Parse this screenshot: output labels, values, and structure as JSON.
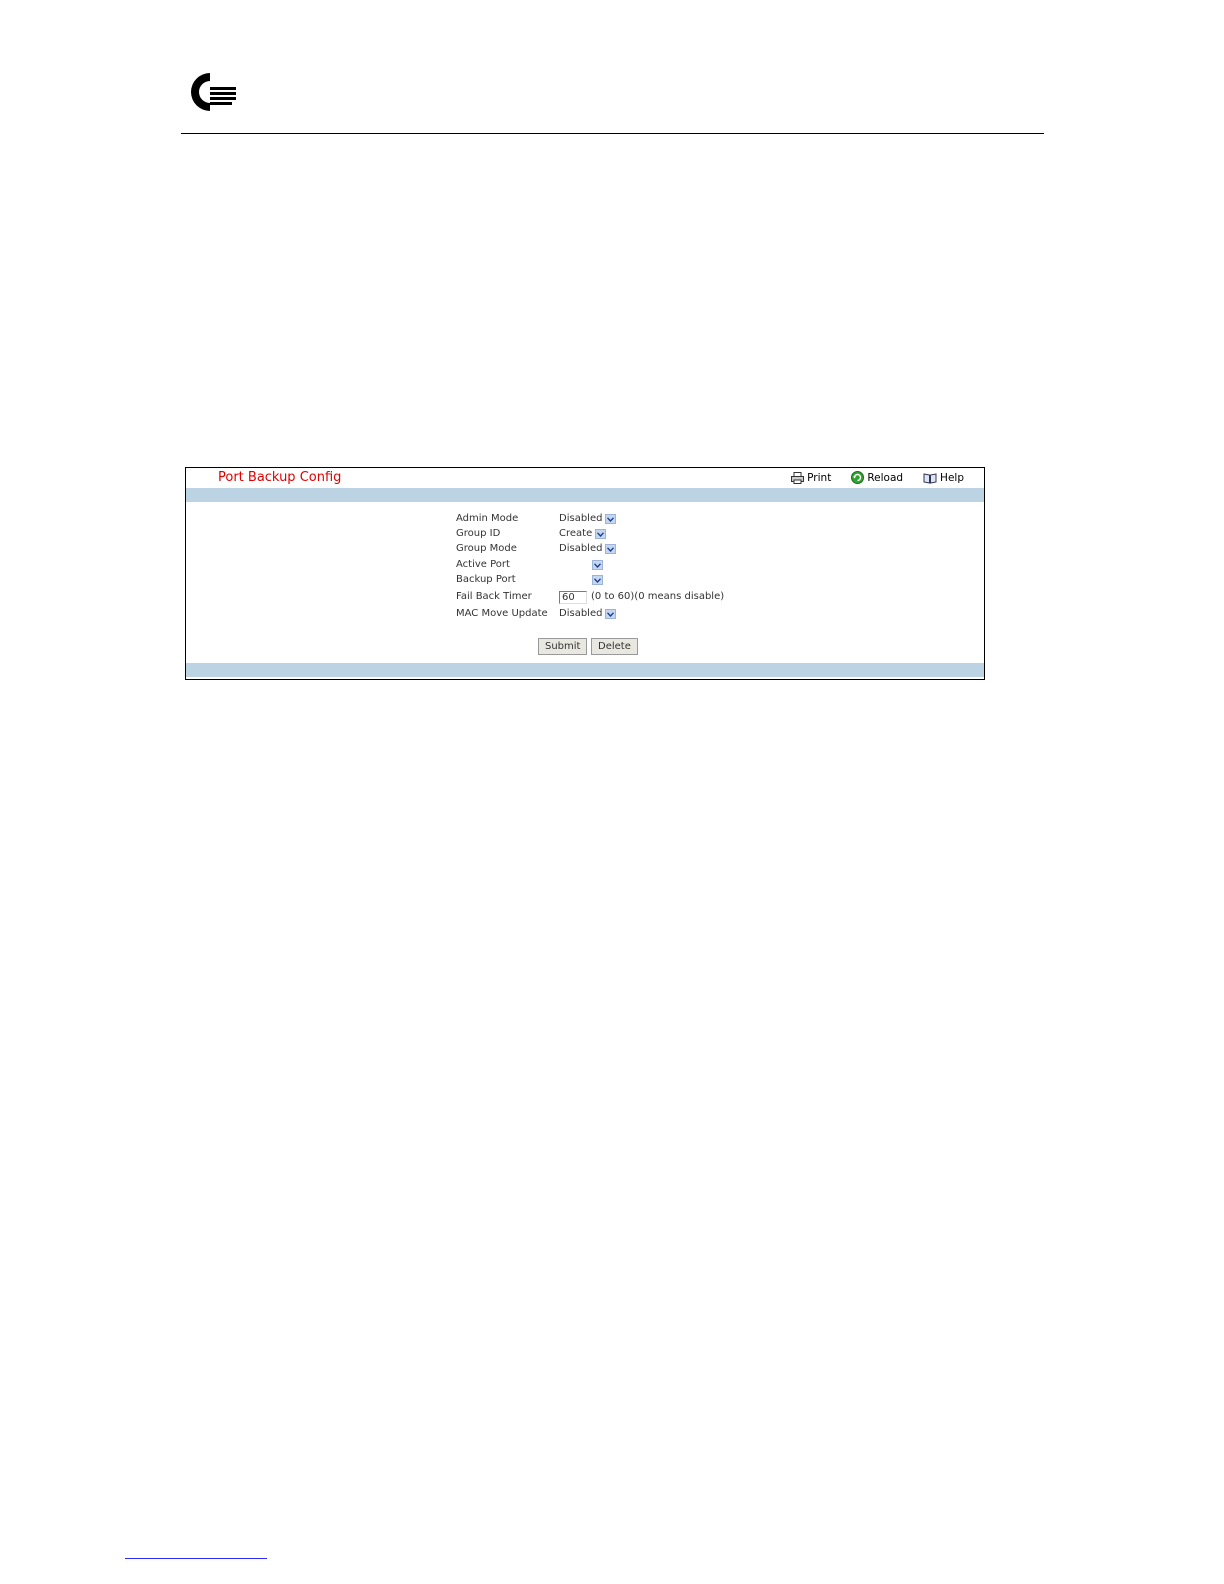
{
  "panel": {
    "title": "Port Backup Config",
    "toolbar": {
      "print": "Print",
      "reload": "Reload",
      "help": "Help"
    }
  },
  "form": {
    "admin_mode": {
      "label": "Admin Mode",
      "value": "Disabled"
    },
    "group_id": {
      "label": "Group ID",
      "value": "Create"
    },
    "group_mode": {
      "label": "Group Mode",
      "value": "Disabled"
    },
    "active_port": {
      "label": "Active Port",
      "value": ""
    },
    "backup_port": {
      "label": "Backup Port",
      "value": ""
    },
    "fail_back_timer": {
      "label": "Fail Back Timer",
      "value": "60",
      "hint": "(0 to 60)(0 means disable)"
    },
    "mac_move_update": {
      "label": "MAC Move Update",
      "value": "Disabled"
    }
  },
  "buttons": {
    "submit": "Submit",
    "delete": "Delete"
  },
  "colors": {
    "title": "#e00000",
    "band": "#bcd3e3"
  }
}
